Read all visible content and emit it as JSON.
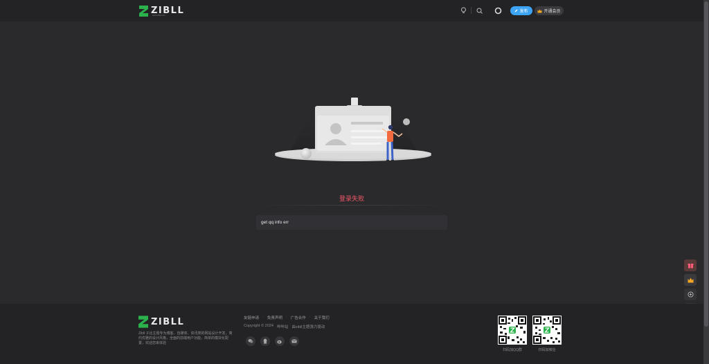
{
  "header": {
    "logo_text": "ZIBLL",
    "logo_sub": "www.zibll.com",
    "publish_label": "发布",
    "vip_label": "开通会员"
  },
  "main": {
    "error_title": "登录失败",
    "error_message": "get qq info err"
  },
  "footer": {
    "logo_text": "ZIBLL",
    "description": "Zibll 子比主题专为博客、自媒体、资讯类的网站设计开发，简约优雅的设计风格，全面的前端用户功能，简单的模块化配置，欢迎您来体验",
    "links": [
      "友链申请",
      "免责声明",
      "广告合作",
      "关于我们"
    ],
    "copyright": "Copyright © 2024",
    "copyright_link": "哔哔站",
    "powered": "由zibll主题强力驱动",
    "qr": [
      {
        "label": "扫码加QQ群"
      },
      {
        "label": "扫码加微信"
      }
    ]
  },
  "icons": {
    "theme_toggle": "lightbulb-icon",
    "search": "search-icon",
    "user": "user-ring-icon",
    "social": [
      "wechat-icon",
      "qq-icon",
      "weibo-icon",
      "email-icon"
    ],
    "float": [
      "gift-icon",
      "crown-icon",
      "add-circle-icon",
      "wechat-icon",
      "qrcode-icon"
    ]
  },
  "colors": {
    "accent_blue": "#3ca4f3",
    "error_red": "#f05767",
    "brand_green": "#2bb24c",
    "background": "#2a2a2d",
    "header_bg": "#232326"
  }
}
